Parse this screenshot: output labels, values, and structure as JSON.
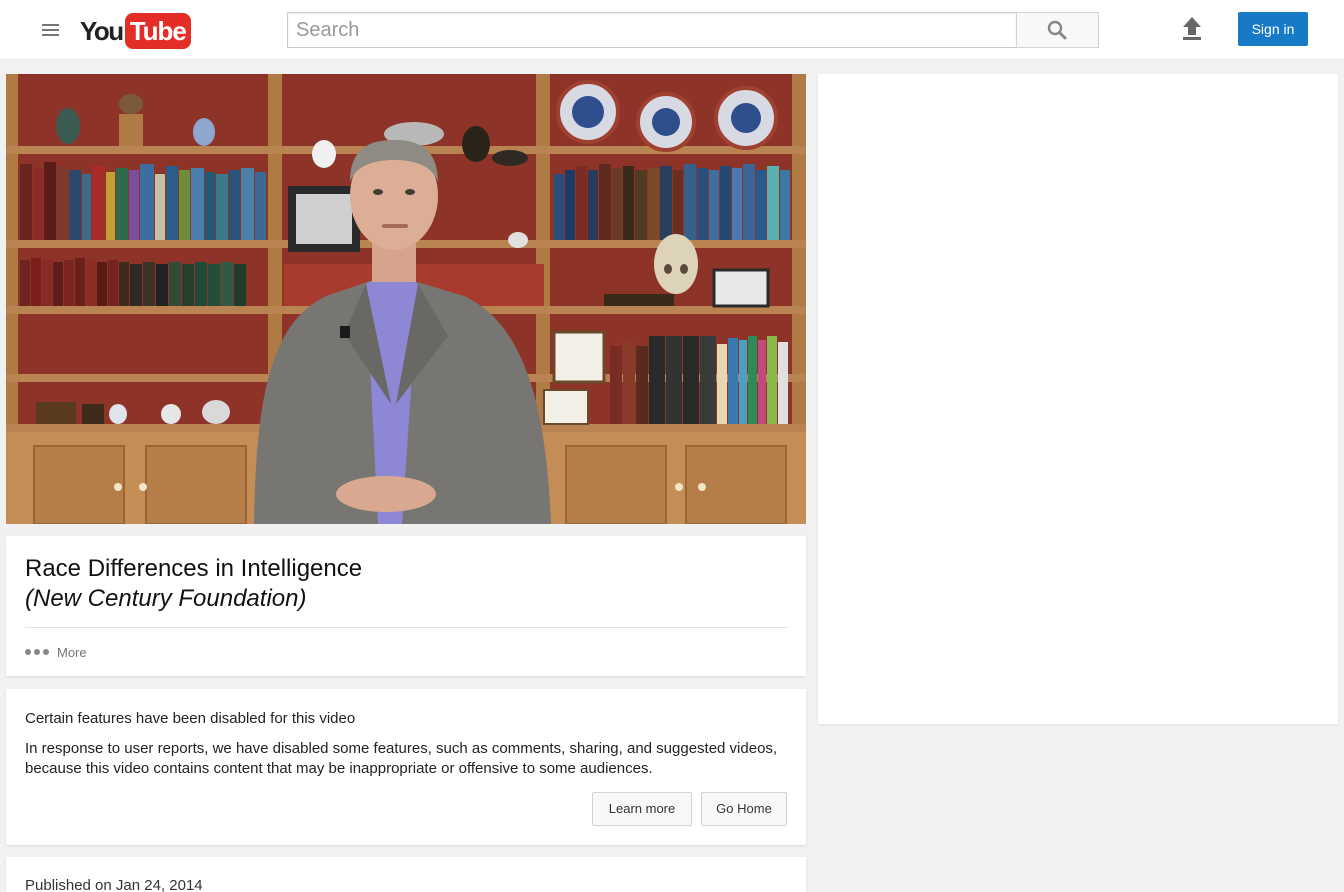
{
  "header": {
    "logo_you": "You",
    "logo_tube": "Tube",
    "search_placeholder": "Search",
    "signin_label": "Sign in"
  },
  "video": {
    "title": "Race Differences in Intelligence",
    "subtitle": "(New Century Foundation)",
    "more_label": "More"
  },
  "notice": {
    "heading": "Certain features have been disabled for this video",
    "body": "In response to user reports, we have disabled some features, such as comments, sharing, and suggested videos, because this video contains content that may be inappropriate or offensive to some audiences.",
    "learn_more_label": "Learn more",
    "go_home_label": "Go Home"
  },
  "published": "Published on Jan 24, 2014",
  "colors": {
    "brand_red": "#e52d27",
    "signin_blue": "#167ac6"
  },
  "icons": [
    "menu-icon",
    "search-icon",
    "upload-icon"
  ]
}
